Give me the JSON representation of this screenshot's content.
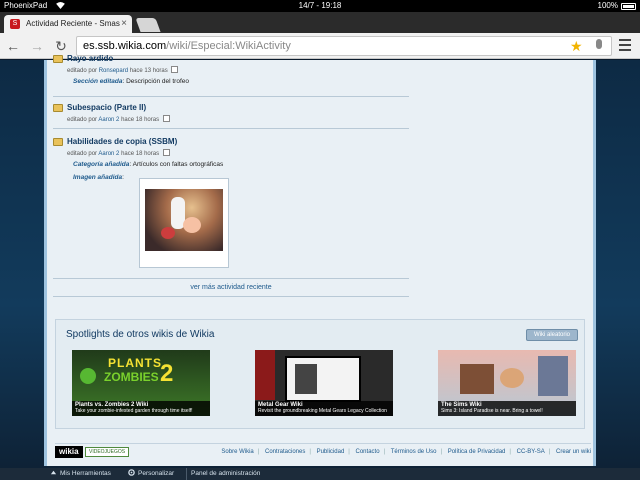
{
  "status_bar": {
    "carrier": "PhoenixPad",
    "time": "14/7 - 19:18",
    "battery": "100%"
  },
  "browser": {
    "tab_title": "Actividad Reciente - Smas",
    "url_host": "es.ssb.wikia.com",
    "url_path": "/wiki/Especial:WikiActivity"
  },
  "activity": [
    {
      "title": "Rayo ardido",
      "meta_prefix": "editado por",
      "user": "Ronsepard",
      "time": "hace 13 horas",
      "detail_label": "Sección editada",
      "detail_text": ": Descripción del trofeo"
    },
    {
      "title": "Subespacio (Parte II)",
      "meta_prefix": "editado por",
      "user": "Aaron 2",
      "time": "hace 18 horas"
    },
    {
      "title": "Habilidades de copia (SSBM)",
      "meta_prefix": "editado por",
      "user": "Aaron 2",
      "time": "hace 18 horas",
      "detail_label": "Categoría añadida",
      "detail_text": ": Artículos con faltas ortográficas",
      "image_label": "Imagen añadida",
      "image_colon": ":"
    }
  ],
  "more_link": "ver más actividad reciente",
  "spotlights": {
    "title": "Spotlights de otros wikis de Wikia",
    "random_button": "Wiki aleatorio",
    "items": [
      {
        "name": "Plants vs. Zombies 2 Wiki",
        "desc": "Take your zombie-infested garden through time itself!",
        "logo_a": "PLANTS",
        "logo_b": "ZOMBIES",
        "logo_c": "2"
      },
      {
        "name": "Metal Gear Wiki",
        "desc": "Revisit the groundbreaking Metal Gears Legacy Collection"
      },
      {
        "name": "The Sims Wiki",
        "desc": "Sims 3: Island Paradise is near. Bring a towel!"
      }
    ]
  },
  "footer": {
    "logo": "wikia",
    "badge": "VIDEOJUEGOS",
    "links": [
      "Sobre Wikia",
      "Contrataciones",
      "Publicidad",
      "Contacto",
      "Términos de Uso",
      "Política de Privacidad",
      "CC-BY-SA",
      "Crear un wiki"
    ]
  },
  "bottom_bar": {
    "tools": "Mis Herramientas",
    "customize": "Personalizar",
    "admin": "Panel de administración"
  }
}
